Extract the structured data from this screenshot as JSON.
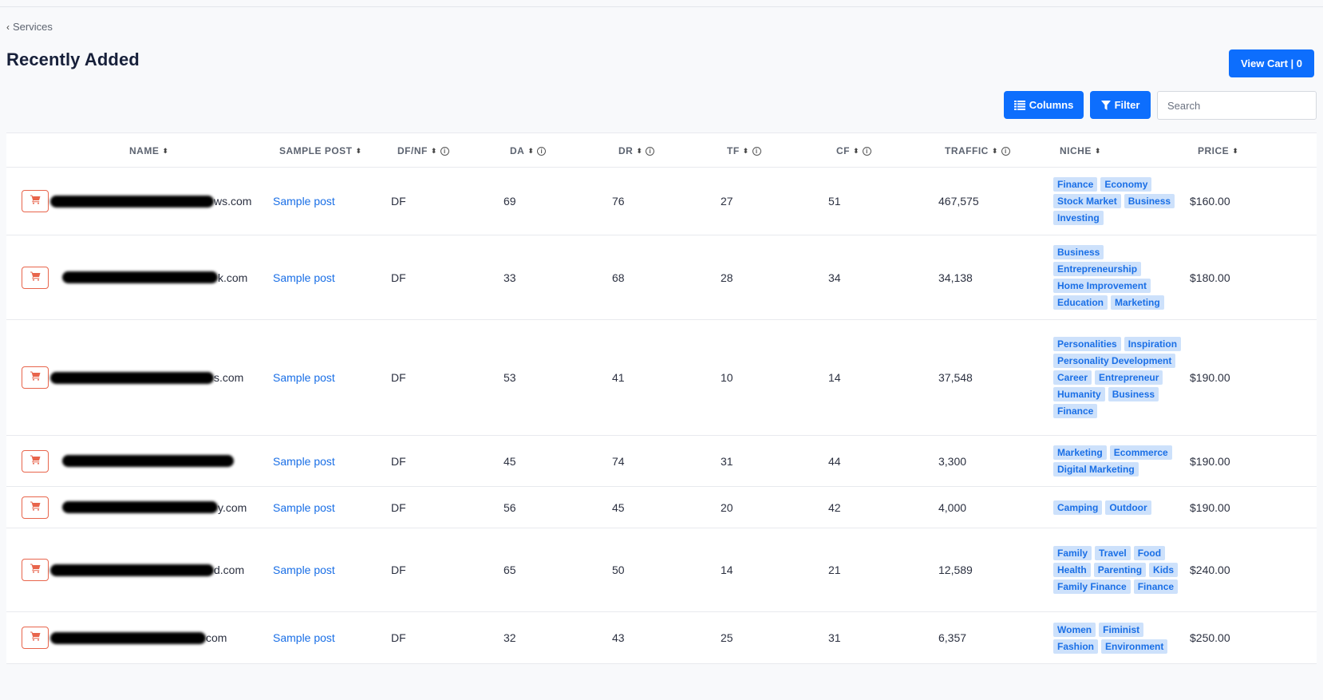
{
  "breadcrumb": {
    "label": "Services"
  },
  "page_title": "Recently Added",
  "cart_button": {
    "label": "View Cart | 0"
  },
  "toolbar": {
    "columns_label": "Columns",
    "filter_label": "Filter",
    "search_placeholder": "Search"
  },
  "columns": {
    "name": "NAME",
    "sample_post": "SAMPLE POST",
    "dfnf": "DF/NF",
    "da": "DA",
    "dr": "DR",
    "tf": "TF",
    "cf": "CF",
    "traffic": "TRAFFIC",
    "niche": "NICHE",
    "price": "PRICE"
  },
  "rows": [
    {
      "domain_suffix": "ws.com",
      "sample": "Sample post",
      "dfnf": "DF",
      "da": "69",
      "dr": "76",
      "tf": "27",
      "cf": "51",
      "traffic": "467,575",
      "niches": [
        "Finance",
        "Economy",
        "Stock Market",
        "Business",
        "Investing"
      ],
      "price": "$160.00"
    },
    {
      "domain_suffix": "k.com",
      "sample": "Sample post",
      "dfnf": "DF",
      "da": "33",
      "dr": "68",
      "tf": "28",
      "cf": "34",
      "traffic": "34,138",
      "niches": [
        "Business",
        "Entrepreneurship",
        "Home Improvement",
        "Education",
        "Marketing"
      ],
      "price": "$180.00"
    },
    {
      "domain_suffix": "s.com",
      "sample": "Sample post",
      "dfnf": "DF",
      "da": "53",
      "dr": "41",
      "tf": "10",
      "cf": "14",
      "traffic": "37,548",
      "niches": [
        "Personalities",
        "Inspiration",
        "Personality Development",
        "Career",
        "Entrepreneur",
        "Humanity",
        "Business",
        "Finance"
      ],
      "price": "$190.00"
    },
    {
      "domain_suffix": "",
      "sample": "Sample post",
      "dfnf": "DF",
      "da": "45",
      "dr": "74",
      "tf": "31",
      "cf": "44",
      "traffic": "3,300",
      "niches": [
        "Marketing",
        "Ecommerce",
        "Digital Marketing"
      ],
      "price": "$190.00"
    },
    {
      "domain_suffix": "y.com",
      "sample": "Sample post",
      "dfnf": "DF",
      "da": "56",
      "dr": "45",
      "tf": "20",
      "cf": "42",
      "traffic": "4,000",
      "niches": [
        "Camping",
        "Outdoor"
      ],
      "price": "$190.00"
    },
    {
      "domain_suffix": "d.com",
      "sample": "Sample post",
      "dfnf": "DF",
      "da": "65",
      "dr": "50",
      "tf": "14",
      "cf": "21",
      "traffic": "12,589",
      "niches": [
        "Family",
        "Travel",
        "Food",
        "Health",
        "Parenting",
        "Kids",
        "Family Finance",
        "Finance"
      ],
      "price": "$240.00"
    },
    {
      "domain_suffix": "com",
      "sample": "Sample post",
      "dfnf": "DF",
      "da": "32",
      "dr": "43",
      "tf": "25",
      "cf": "31",
      "traffic": "6,357",
      "niches": [
        "Women",
        "Fiminist",
        "Fashion",
        "Environment"
      ],
      "price": "$250.00"
    }
  ],
  "colors": {
    "primary": "#0d6efd",
    "cart_outline": "#e8654c",
    "tag_bg": "#cde1fb",
    "tag_text": "#1a6fe6"
  },
  "icons": {
    "breadcrumb": "chevron-left-icon",
    "columns": "columns-icon",
    "filter": "filter-icon",
    "cart": "shopping-cart-icon",
    "sort": "sort-icon",
    "info": "info-icon"
  }
}
